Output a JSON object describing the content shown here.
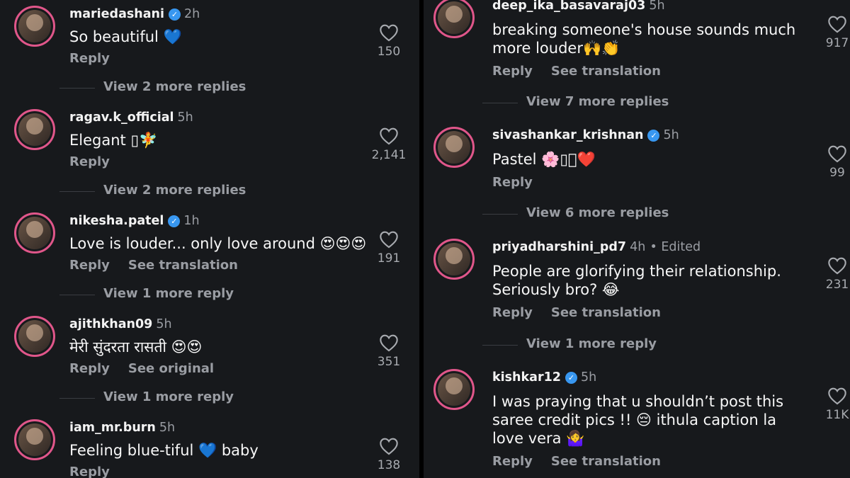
{
  "left": {
    "comments": [
      {
        "username": "mariedashani",
        "verified": true,
        "time": "2h",
        "text": "So beautiful 💙",
        "actions": [
          "Reply"
        ],
        "likes": "150",
        "view_more": "View 2 more replies"
      },
      {
        "username": "ragav.k_official",
        "verified": false,
        "time": "5h",
        "text": "Elegant ▯🧚",
        "actions": [
          "Reply"
        ],
        "likes": "2,141",
        "view_more": "View 2 more replies"
      },
      {
        "username": "nikesha.patel",
        "verified": true,
        "time": "1h",
        "text": "Love is louder... only love around 😍😍😍",
        "actions": [
          "Reply",
          "See translation"
        ],
        "likes": "191",
        "view_more": "View 1 more reply"
      },
      {
        "username": "ajithkhan09",
        "verified": false,
        "time": "5h",
        "text": "मेरी सुंदरता रासती 😍😍",
        "actions": [
          "Reply",
          "See original"
        ],
        "likes": "351",
        "view_more": "View 1 more reply"
      },
      {
        "username": "iam_mr.burn",
        "verified": false,
        "time": "5h",
        "text": "Feeling blue-tiful 💙 baby",
        "actions": [
          "Reply"
        ],
        "likes": "138",
        "view_more": ""
      }
    ]
  },
  "right": {
    "comments": [
      {
        "username": "deep_ika_basavaraj03",
        "verified": false,
        "time": "5h",
        "text": "breaking someone's house sounds much\nmore louder🙌👏",
        "actions": [
          "Reply",
          "See translation"
        ],
        "likes": "917",
        "view_more": "View 7 more replies"
      },
      {
        "username": "sivashankar_krishnan",
        "verified": true,
        "time": "5h",
        "text": "Pastel 🌸▯🏻❤️",
        "actions": [
          "Reply"
        ],
        "likes": "99",
        "view_more": "View 6 more replies"
      },
      {
        "username": "priyadharshini_pd7",
        "verified": false,
        "time": "4h",
        "edited": "• Edited",
        "text": "People are glorifying their relationship.\nSeriously bro? 😂",
        "actions": [
          "Reply",
          "See translation"
        ],
        "likes": "231",
        "view_more": "View 1 more reply"
      },
      {
        "username": "kishkar12",
        "verified": true,
        "time": "5h",
        "text": "I was praying that u shouldn’t post this\nsaree credit pics !! 😔 ithula caption la\nlove vera 🤷‍♀️",
        "actions": [
          "Reply",
          "See translation"
        ],
        "likes": "11K",
        "view_more": ""
      }
    ]
  },
  "colors": {
    "background": "#17191c",
    "verified": "#3897f0",
    "ring": "#e0568a",
    "muted": "#9a9da3"
  },
  "icons": {
    "like": "heart-outline-icon",
    "verified": "verified-badge-icon"
  }
}
